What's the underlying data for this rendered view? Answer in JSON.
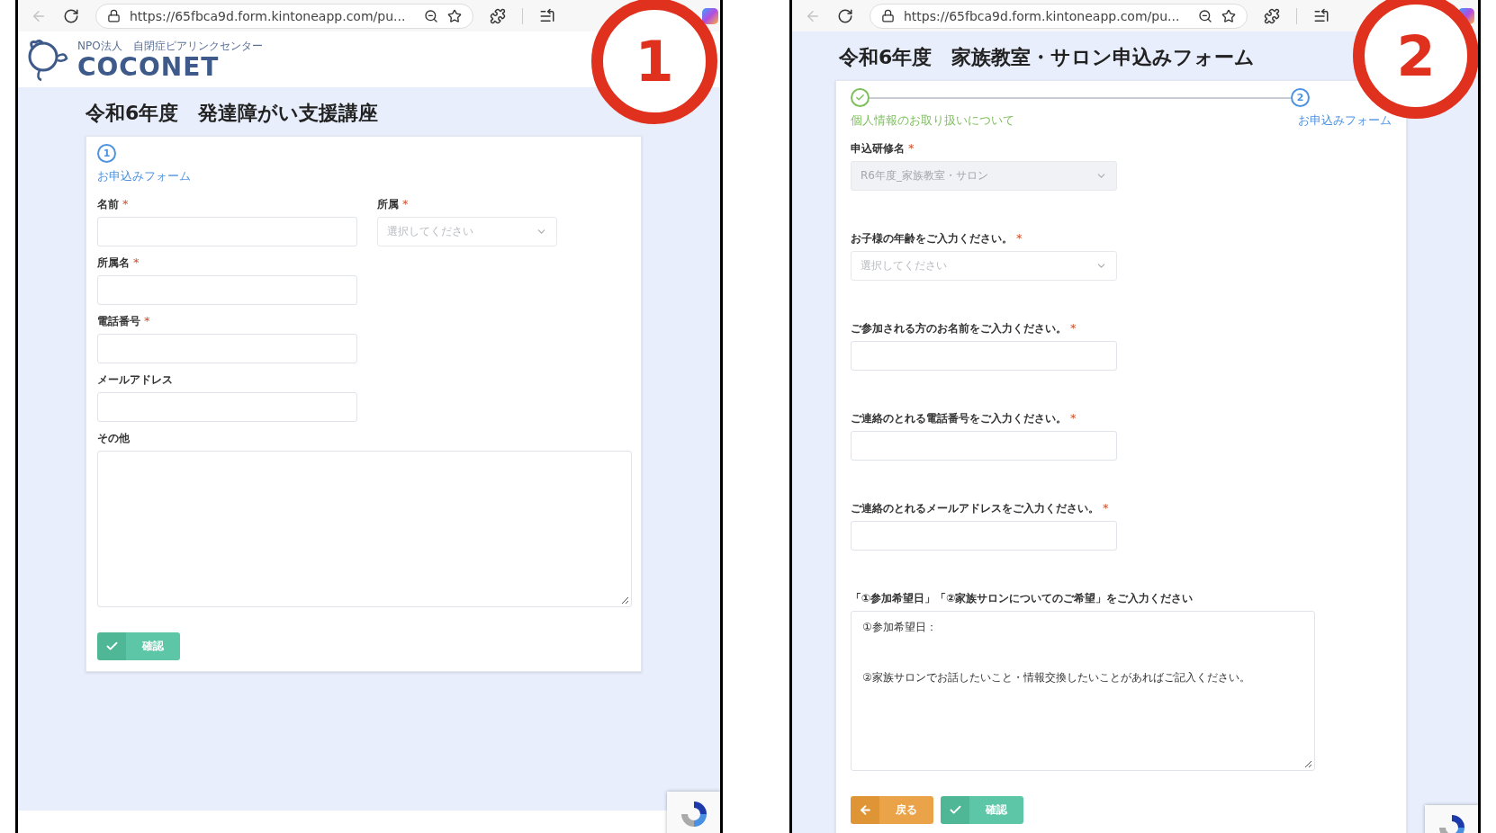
{
  "panels": [
    {
      "badge": "1",
      "browser": {
        "url": "https://65fbca9d.form.kintoneapp.com/pu...",
        "back_disabled": true
      },
      "logo": {
        "tagline": "NPO法人　自閉症ピアリンクセンター",
        "name": "COCONET"
      },
      "title": "令和6年度　発達障がい支援講座",
      "steps": [
        {
          "number": "1",
          "label": "お申込みフォーム",
          "done": false
        }
      ],
      "rows": [
        [
          {
            "label": "名前",
            "required_mark": "*",
            "kind": "text"
          },
          {
            "label": "所属",
            "required_mark": "*",
            "kind": "select",
            "placeholder": "選択してください",
            "disabled": false
          }
        ],
        [
          {
            "label": "所属名",
            "required_mark": "*",
            "kind": "text"
          }
        ],
        [
          {
            "label": "電話番号",
            "required_mark": "*",
            "kind": "text"
          }
        ],
        [
          {
            "label": "メールアドレス",
            "kind": "text"
          }
        ],
        [
          {
            "label": "その他",
            "kind": "textarea"
          }
        ]
      ],
      "buttons": [
        {
          "label": "確認",
          "kind": "confirm"
        }
      ]
    },
    {
      "badge": "2",
      "browser": {
        "url": "https://65fbca9d.form.kintoneapp.com/pu...",
        "back_disabled": true
      },
      "title": "令和6年度　家族教室・サロン申込みフォーム",
      "steps": [
        {
          "label": "個人情報のお取り扱いについて",
          "done": true
        },
        {
          "number": "2",
          "label": "お申込みフォーム",
          "done": false
        }
      ],
      "rows": [
        [
          {
            "label": "申込研修名",
            "required_mark": "*",
            "kind": "select",
            "value": "R6年度_家族教室・サロン",
            "disabled": true
          }
        ],
        [
          {
            "label": "お子様の年齢をご入力ください。",
            "required_mark": "*",
            "kind": "select",
            "placeholder": "選択してください",
            "disabled": false
          }
        ],
        [
          {
            "label": "ご参加される方のお名前をご入力ください。",
            "required_mark": "*",
            "kind": "text"
          }
        ],
        [
          {
            "label": "ご連絡のとれる電話番号をご入力ください。",
            "required_mark": "*",
            "kind": "text"
          }
        ],
        [
          {
            "label": "ご連絡のとれるメールアドレスをご入力ください。",
            "required_mark": "*",
            "kind": "text"
          }
        ],
        [
          {
            "label": "「①参加希望日」「②家族サロンについてのご希望」をご入力ください",
            "kind": "textarea",
            "value": "①参加希望日：\n\n\n②家族サロンでお話したいこと・情報交換したいことがあればご記入ください。"
          }
        ]
      ],
      "buttons": [
        {
          "label": "戻る",
          "kind": "back"
        },
        {
          "label": "確認",
          "kind": "confirm"
        }
      ]
    }
  ]
}
